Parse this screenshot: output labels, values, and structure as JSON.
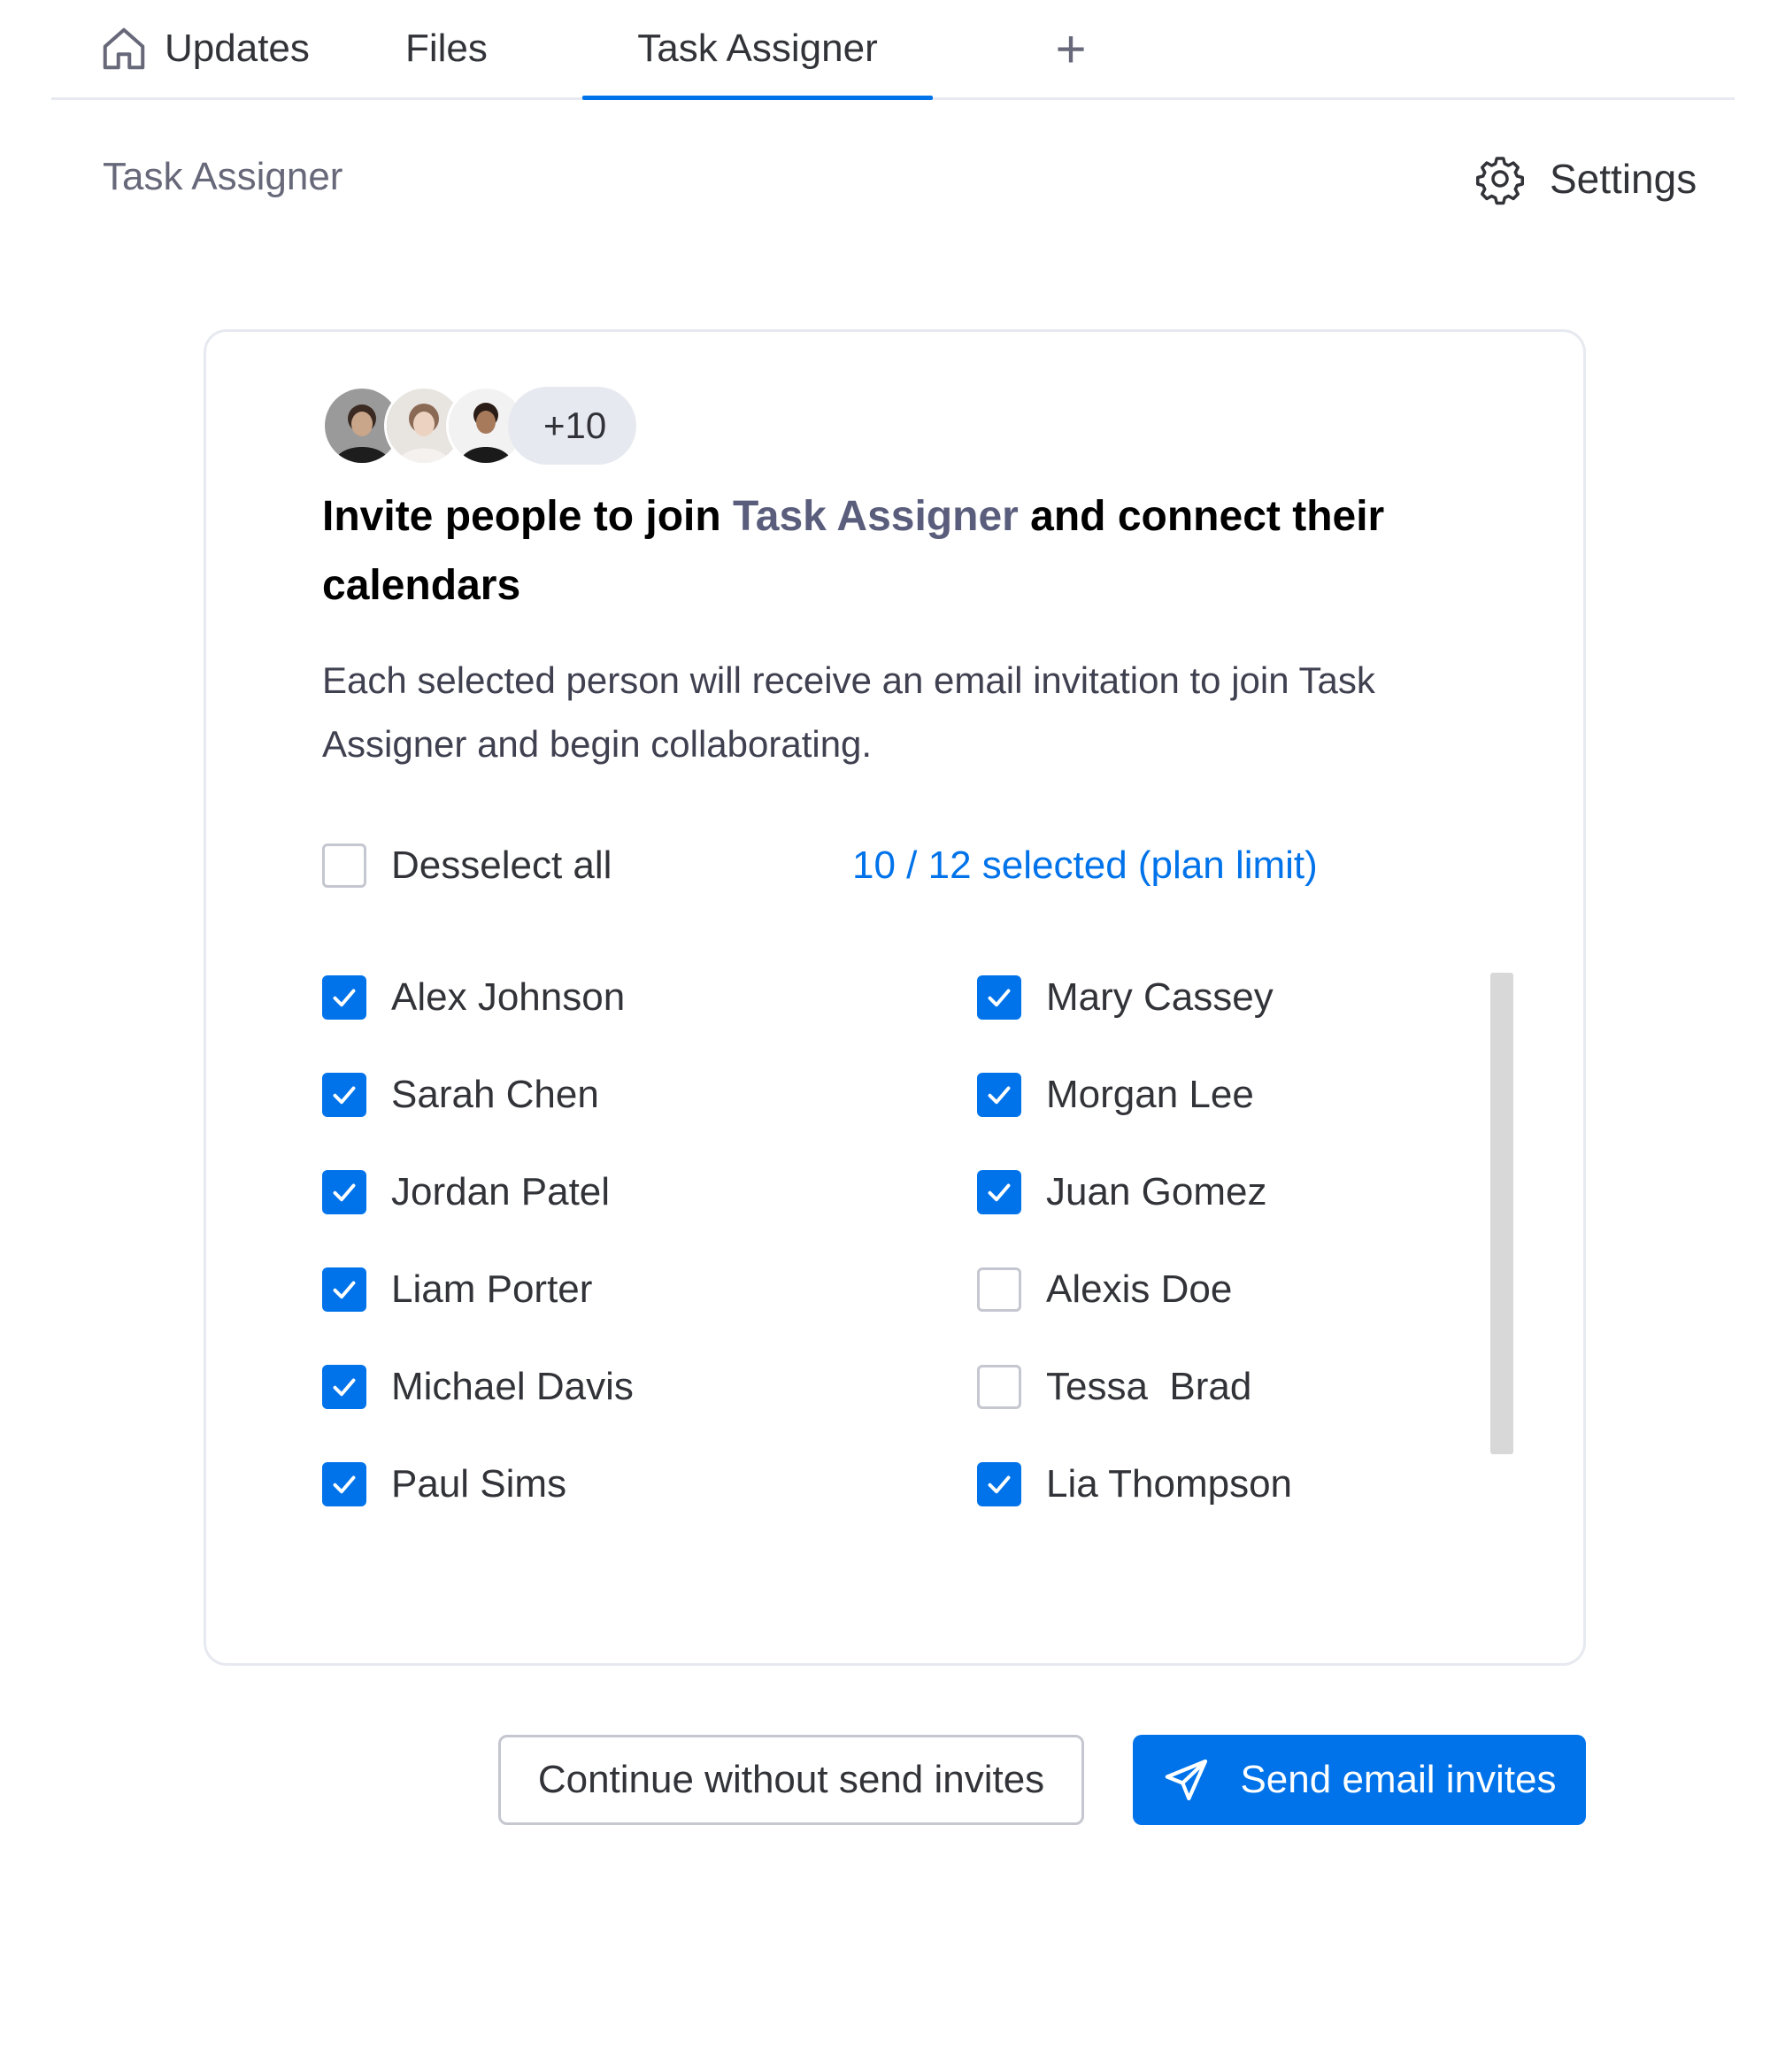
{
  "tabs": [
    {
      "label": "Updates",
      "icon": "home-icon"
    },
    {
      "label": "Files"
    },
    {
      "label": "Task Assigner",
      "active": true
    }
  ],
  "add_tab_label": "+",
  "header": {
    "title": "Task Assigner",
    "settings_label": "Settings"
  },
  "invite": {
    "avatar_more": "+10",
    "heading_prefix": "Invite people to join ",
    "heading_accent": "Task Assigner",
    "heading_suffix": " and connect their calendars",
    "description": "Each selected person will receive an email invitation to join Task Assigner and begin collaborating.",
    "deselect_label": "Desselect all",
    "selected_count": "10 / 12 selected (plan limit)",
    "people": [
      {
        "name": "Alex Johnson",
        "checked": true
      },
      {
        "name": "Sarah Chen",
        "checked": true
      },
      {
        "name": "Jordan Patel",
        "checked": true
      },
      {
        "name": "Liam Porter",
        "checked": true
      },
      {
        "name": "Michael Davis",
        "checked": true
      },
      {
        "name": "Paul Sims",
        "checked": true
      },
      {
        "name": "Mary Cassey",
        "checked": true
      },
      {
        "name": "Morgan Lee",
        "checked": true
      },
      {
        "name": "Juan Gomez",
        "checked": true
      },
      {
        "name": "Alexis Doe",
        "checked": false
      },
      {
        "name": "Tessa  Brad",
        "checked": false
      },
      {
        "name": "Lia Thompson",
        "checked": true
      }
    ]
  },
  "actions": {
    "skip_label": "Continue without send invites",
    "send_label": "Send email invites"
  },
  "colors": {
    "accent": "#0073ea",
    "heading_accent": "#5a5e7c",
    "muted": "#676879",
    "border": "#e6e9ef"
  }
}
